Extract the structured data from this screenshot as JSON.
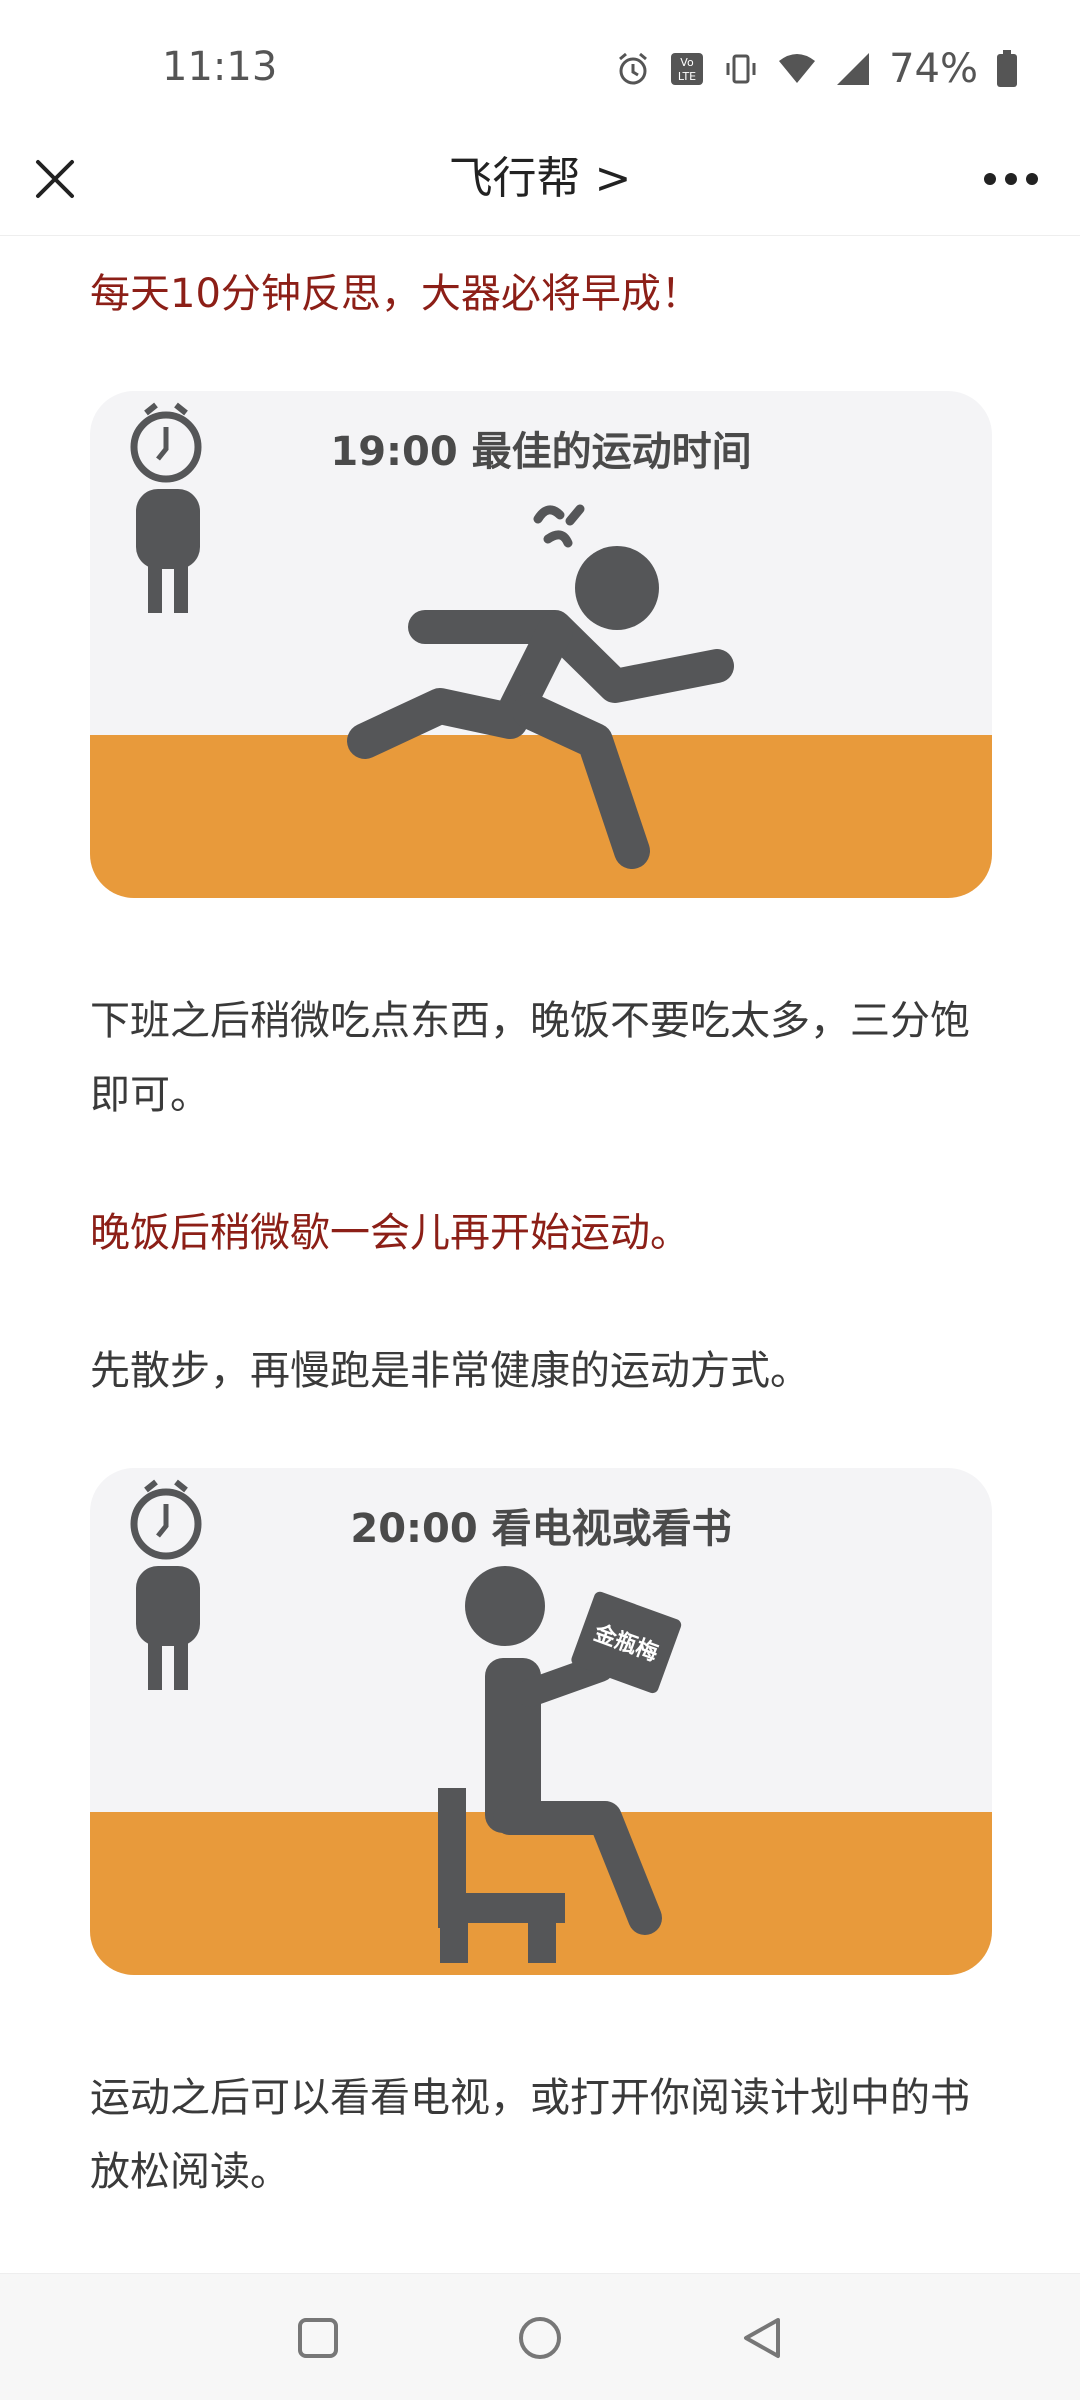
{
  "status_bar": {
    "time": "11:13",
    "battery_percent": "74%",
    "icons": [
      "alarm-icon",
      "volte-icon",
      "vibrate-icon",
      "wifi-icon",
      "signal-icon",
      "battery-icon"
    ]
  },
  "nav": {
    "title": "飞行帮 >",
    "close_icon": "close-icon",
    "more_icon": "more-icon"
  },
  "article": {
    "intro": "每天10分钟反思，大器必将早成！",
    "illustration_1": {
      "caption": "19:00 最佳的运动时间"
    },
    "paragraph_1": "下班之后稍微吃点东西，晚饭不要吃太多，三分饱即可。",
    "highlight_1": "晚饭后稍微歇一会儿再开始运动。",
    "paragraph_2": "先散步，再慢跑是非常健康的运动方式。",
    "illustration_2": {
      "caption": "20:00 看电视或看书",
      "book_label": "金瓶梅"
    },
    "paragraph_3": "运动之后可以看看电视，或打开你阅读计划中的书放松阅读。"
  },
  "system_nav": {
    "buttons": [
      "recents-button",
      "home-button",
      "back-button"
    ]
  },
  "colors": {
    "accent_red": "#8c1f17",
    "floor_orange": "#e89a3b",
    "figure_gray": "#555658"
  }
}
